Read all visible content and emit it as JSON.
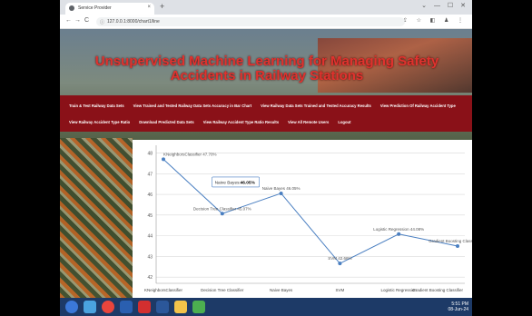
{
  "browser": {
    "tab_title": "Service Provider",
    "tab_close": "×",
    "new_tab": "+",
    "window_controls": "⌄ — ☐ ✕",
    "back": "←",
    "forward": "→",
    "reload": "C",
    "url": "127.0.0.1:8000/chart1/line",
    "right_icons": "⇪ ☆ ◧ ♟ ⋮"
  },
  "page": {
    "title": "Unsupervised Machine Learning for Managing Safety Accidents in Railway Stations",
    "nav_row1": [
      "Train & Test Railway Data Sets",
      "View Trained and Tested Railway Data Sets Accuracy in Bar Chart",
      "View Railway Data Sets Trained and Tested Accuracy Results",
      "View Prediction Of Railway Accident Type"
    ],
    "nav_row2": [
      "View Railway Accident Type Ratio",
      "Download Predicted Data Sets",
      "View Railway Accident Type Ratio Results",
      "View All Remote Users",
      "Logout"
    ]
  },
  "chart_data": {
    "type": "line",
    "categories": [
      "KNeighborsClassifier",
      "Decision Tree Classifier",
      "Naive Bayes",
      "SVM",
      "Logistic Regression",
      "Gradient Boosting Classifier"
    ],
    "values": [
      47.7,
      45.07,
      46.05,
      42.66,
      44.08,
      43.5
    ],
    "point_labels": [
      "KNeighborsClassifier 47.70%",
      "Decision Tree Classifier 45.07%",
      "Naive Bayes 46.05%",
      "SVM 42.66%",
      "Logistic Regression 44.08%",
      "Gradient Boosting Classifier 4"
    ],
    "y_ticks": [
      "42",
      "43",
      "44",
      "45",
      "46",
      "47",
      "48"
    ],
    "ylim": [
      41.7,
      48.2
    ],
    "tooltip": {
      "label": "Naive Bayes:",
      "value": "46.05%"
    },
    "color": "#4a7fc1",
    "grid": true
  },
  "taskbar": {
    "time": "5:51 PM",
    "date": "08-Jun-24"
  }
}
